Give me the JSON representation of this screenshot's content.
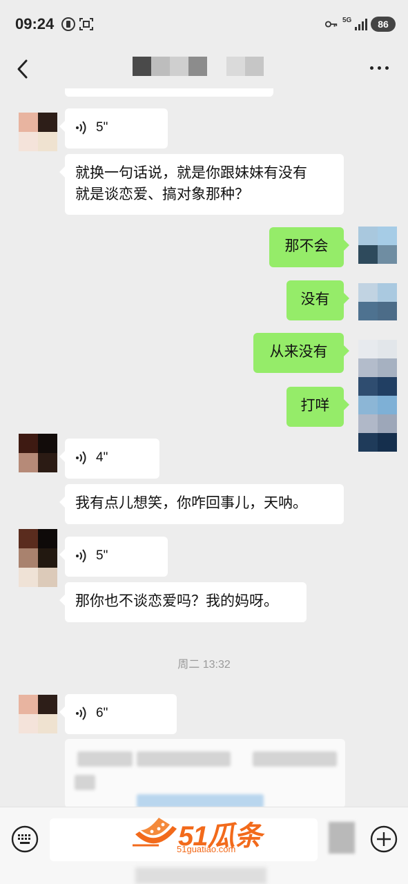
{
  "status_bar": {
    "time": "09:24",
    "network": "5G",
    "battery": "86",
    "icons": [
      "record-icon",
      "screenshot-icon",
      "key-icon",
      "signal-icon"
    ]
  },
  "nav": {
    "title": "",
    "back_icon": "chevron-left-icon",
    "more_icon": "more-dots-icon"
  },
  "messages": [
    {
      "side": "left",
      "type": "voice",
      "duration": "5\""
    },
    {
      "side": "left",
      "type": "text",
      "text": "就换一句话说，就是你跟妹妹有没有\n就是谈恋爱、搞对象那种？"
    },
    {
      "side": "right",
      "type": "text",
      "text": "那不会"
    },
    {
      "side": "right",
      "type": "text",
      "text": "没有"
    },
    {
      "side": "right",
      "type": "text",
      "text": "从来没有"
    },
    {
      "side": "right",
      "type": "text",
      "text": "打咩"
    },
    {
      "side": "left",
      "type": "voice",
      "duration": "4\""
    },
    {
      "side": "left",
      "type": "text",
      "text": "我有点儿想笑，你咋回事儿，天呐。"
    },
    {
      "side": "left",
      "type": "voice",
      "duration": "5\""
    },
    {
      "side": "left",
      "type": "text",
      "text": "那你也不谈恋爱吗？我的妈呀。"
    },
    {
      "side": "center",
      "type": "time",
      "text": "周二 13:32"
    },
    {
      "side": "left",
      "type": "voice",
      "duration": "6\""
    }
  ],
  "watermark": {
    "brand": "51瓜条",
    "domain": "51guatiao.com"
  },
  "colors": {
    "background": "#ededed",
    "my_bubble": "#95ec69",
    "their_bubble": "#ffffff",
    "watermark": "#f26a1b"
  }
}
